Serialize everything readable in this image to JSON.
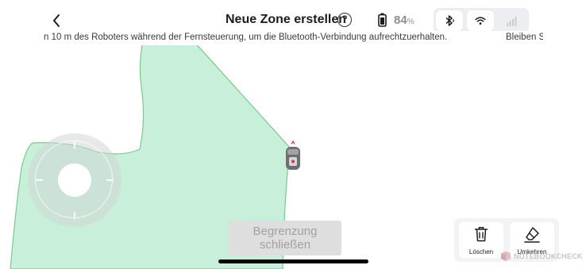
{
  "header": {
    "title": "Neue Zone erstellen",
    "help_label": "?",
    "battery_value": "84",
    "battery_unit": "%"
  },
  "hint_banner": {
    "text": "n 10 m des Roboters während der Fernsteuerung, um die Bluetooth-Verbindung aufrechtzuerhalten.",
    "text_next": "Bleiben S"
  },
  "connection": {
    "bluetooth_active": true,
    "wifi_active": true,
    "cellular_active": false
  },
  "map": {
    "zone_fill": "#c8efd9",
    "zone_edge": "#7cc98e"
  },
  "actions": {
    "close_boundary_label": "Begrenzung schließen"
  },
  "tools": {
    "delete_label": "Löschen",
    "undo_label": "Umkehren"
  },
  "watermark": {
    "text": "NOTEBOOKCHECK"
  },
  "icons": {
    "back": "chevron-left-icon",
    "help": "question-circle-icon",
    "battery": "battery-icon",
    "bluetooth": "bluetooth-icon",
    "wifi": "wifi-icon",
    "cellular": "cellular-signal-icon",
    "delete": "trash-icon",
    "undo": "eraser-icon",
    "robot": "robot-mower-icon"
  },
  "colors": {
    "accent_red": "#e2333b",
    "disabled_button": "#dedede",
    "disabled_text": "#a1a1a1"
  }
}
